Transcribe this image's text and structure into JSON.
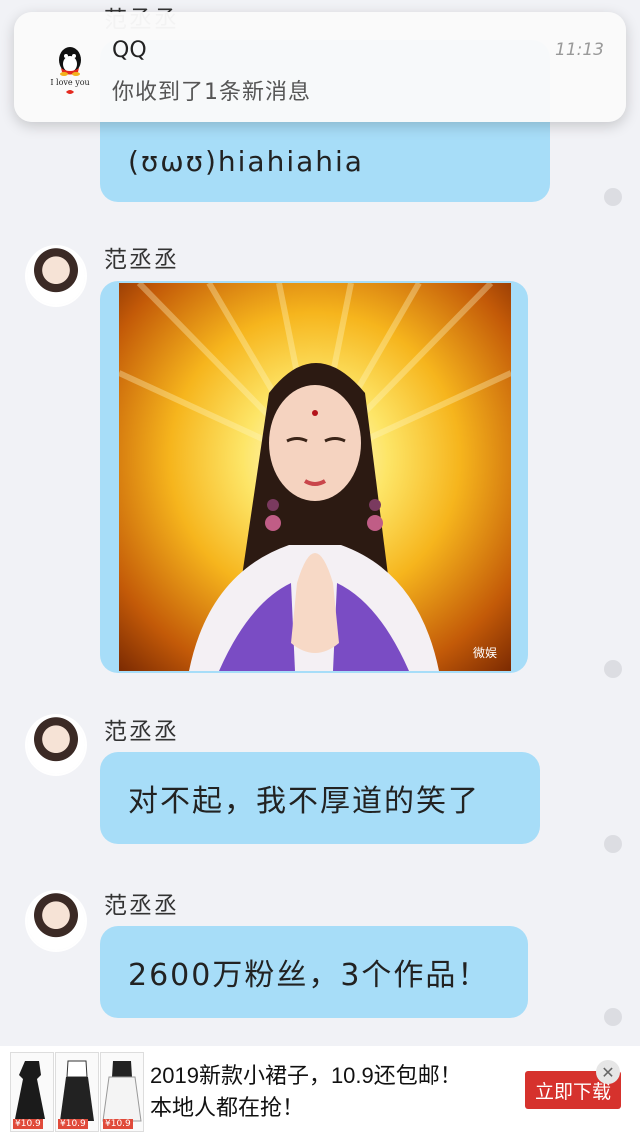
{
  "notification": {
    "app": "QQ",
    "message": "你收到了1条新消息",
    "time": "11:13",
    "logo_caption": "I love you",
    "icon": "qq-penguin-icon"
  },
  "chat": {
    "top_partial_sender": "范丞丞",
    "top_partial_text": "(ʊωʊ)hiahiahia",
    "messages": [
      {
        "sender": "范丞丞",
        "type": "image",
        "caption": "微娱"
      },
      {
        "sender": "范丞丞",
        "type": "text",
        "text": "对不起，我不厚道的笑了"
      },
      {
        "sender": "范丞丞",
        "type": "text",
        "text": "2600万粉丝，3个作品！"
      }
    ]
  },
  "ad": {
    "line1": "2019新款小裙子，10.9还包邮！",
    "line2": "本地人都在抢！",
    "button": "立即下载",
    "close": "✕",
    "price_tags": [
      "¥10.9",
      "¥10.9",
      "¥10.9"
    ]
  },
  "colors": {
    "bubble": "#a7ddf8",
    "background": "#f1f2f6",
    "ad_button": "#d6322d"
  }
}
